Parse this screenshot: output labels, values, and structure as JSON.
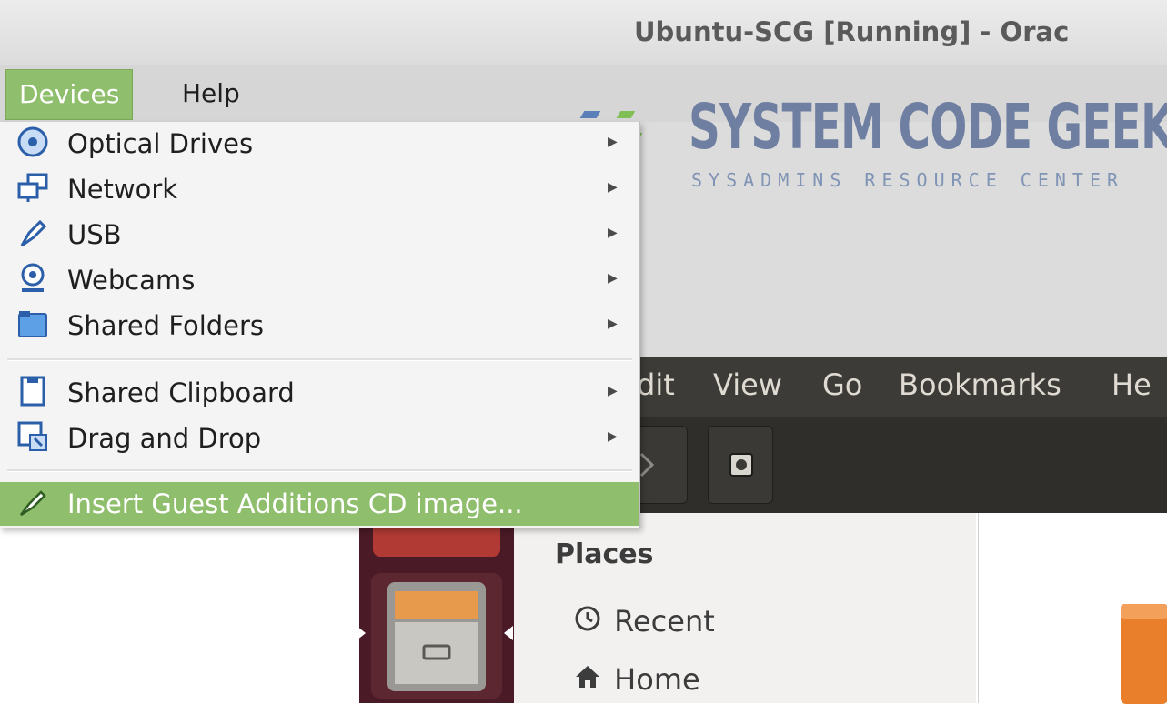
{
  "window": {
    "title": "Ubuntu-SCG [Running] - Orac"
  },
  "menubar": {
    "items": [
      {
        "label": "Devices",
        "active": true
      },
      {
        "label": "Help",
        "active": false
      }
    ]
  },
  "logo": {
    "name": "SYSTEM CODE GEEKS",
    "tagline": "SYSADMINS RESOURCE CENTER"
  },
  "devices_menu": {
    "items": [
      {
        "label": "Optical Drives",
        "icon": "optical-disc-icon",
        "submenu": true
      },
      {
        "label": "Network",
        "icon": "network-icon",
        "submenu": true
      },
      {
        "label": "USB",
        "icon": "usb-icon",
        "submenu": true
      },
      {
        "label": "Webcams",
        "icon": "webcam-icon",
        "submenu": true
      },
      {
        "label": "Shared Folders",
        "icon": "folder-icon",
        "submenu": true
      },
      {
        "label": "Shared Clipboard",
        "icon": "clipboard-icon",
        "submenu": true
      },
      {
        "label": "Drag and Drop",
        "icon": "drag-drop-icon",
        "submenu": true
      },
      {
        "label": "Insert Guest Additions CD image...",
        "icon": "cd-insert-icon",
        "submenu": false,
        "highlighted": true
      }
    ]
  },
  "nautilus": {
    "menu": [
      "dit",
      "View",
      "Go",
      "Bookmarks",
      "He"
    ],
    "places": {
      "heading": "Places",
      "items": [
        {
          "label": "Recent",
          "icon": "clock-icon"
        },
        {
          "label": "Home",
          "icon": "home-icon"
        }
      ]
    }
  },
  "colors": {
    "highlight": "#8fbe6c",
    "accent_blue": "#2b5fa9",
    "launcher": "#4a1a26",
    "nautilus_bar": "#3c3b37"
  }
}
